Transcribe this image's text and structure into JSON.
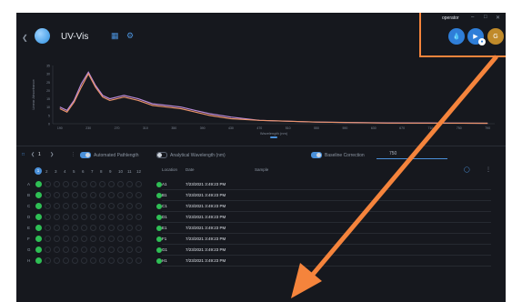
{
  "app": {
    "title": "UV-Vis",
    "back_icon": "chevron-left-icon",
    "title_icons": [
      "grid-icon",
      "settings-icon"
    ]
  },
  "user": {
    "name": "operator"
  },
  "window_controls": [
    "minimize-icon",
    "maximize-icon",
    "close-icon"
  ],
  "header_buttons": {
    "avatar_initial": "G",
    "colors": {
      "accent": "#2f7ed8",
      "avatar": "#c08a2a"
    }
  },
  "chart": {
    "type": "line",
    "ylabel": "Linear Absorbance",
    "xlabel": "Wavelength (nm)",
    "y_ticks": [
      "35",
      "30",
      "25",
      "20",
      "15",
      "10",
      "5",
      "0"
    ],
    "x_ticks": [
      "190",
      "230",
      "270",
      "310",
      "350",
      "390",
      "430",
      "470",
      "510",
      "550",
      "590",
      "630",
      "670",
      "710",
      "750",
      "790"
    ]
  },
  "chart_data": {
    "type": "line",
    "xlabel": "Wavelength (nm)",
    "ylabel": "Linear Absorbance",
    "xlim": [
      180,
      800
    ],
    "ylim": [
      0,
      35
    ],
    "series": [
      {
        "x": [
          190,
          200,
          210,
          220,
          230,
          240,
          250,
          260,
          270,
          280,
          290,
          300,
          320,
          340,
          360,
          380,
          400,
          430,
          470,
          550,
          650,
          790
        ],
        "y": [
          10,
          8,
          14,
          24,
          31,
          23,
          17,
          15,
          16,
          17,
          16,
          15,
          12,
          11,
          10,
          8,
          6,
          4,
          2,
          1,
          0.5,
          0.3
        ],
        "color": "#b98ad8"
      },
      {
        "x": [
          190,
          200,
          210,
          220,
          230,
          240,
          250,
          260,
          270,
          280,
          290,
          300,
          320,
          340,
          360,
          380,
          400,
          430,
          470,
          550,
          650,
          790
        ],
        "y": [
          9,
          7,
          13,
          22,
          30,
          22,
          16,
          14,
          15,
          16,
          15,
          14,
          11,
          10,
          9,
          7,
          5,
          3,
          2,
          1,
          0.4,
          0.3
        ],
        "color": "#e8926a"
      }
    ]
  },
  "toolbar": {
    "page": "1",
    "automated_pathlength": "Automated Pathlength",
    "analytical_wavelength": "Analytical Wavelength (nm)",
    "baseline_correction": "Baseline Correction",
    "wavelength_value": "750",
    "toggles": {
      "automated_pathlength": true,
      "analytical_wavelength": false,
      "baseline_correction": true
    }
  },
  "plate": {
    "columns": [
      "1",
      "2",
      "3",
      "4",
      "5",
      "6",
      "7",
      "8",
      "9",
      "10",
      "11",
      "12"
    ],
    "rows": [
      "A",
      "B",
      "C",
      "D",
      "E",
      "F",
      "G",
      "H"
    ],
    "selected_column": "1"
  },
  "table": {
    "headers": {
      "location": "Location",
      "date": "Date",
      "sample": "Sample"
    },
    "rows": [
      {
        "location": "A1",
        "date": "7/23/2021 3:49:23 PM",
        "sample": ""
      },
      {
        "location": "B1",
        "date": "7/23/2021 3:49:23 PM",
        "sample": ""
      },
      {
        "location": "C1",
        "date": "7/23/2021 3:49:23 PM",
        "sample": ""
      },
      {
        "location": "D1",
        "date": "7/23/2021 3:49:23 PM",
        "sample": ""
      },
      {
        "location": "E1",
        "date": "7/23/2021 3:49:23 PM",
        "sample": ""
      },
      {
        "location": "F1",
        "date": "7/23/2021 3:49:23 PM",
        "sample": ""
      },
      {
        "location": "G1",
        "date": "7/23/2021 3:49:23 PM",
        "sample": ""
      },
      {
        "location": "H1",
        "date": "7/23/2021 3:49:23 PM",
        "sample": ""
      }
    ]
  },
  "annotation": {
    "color": "#f5843c"
  }
}
